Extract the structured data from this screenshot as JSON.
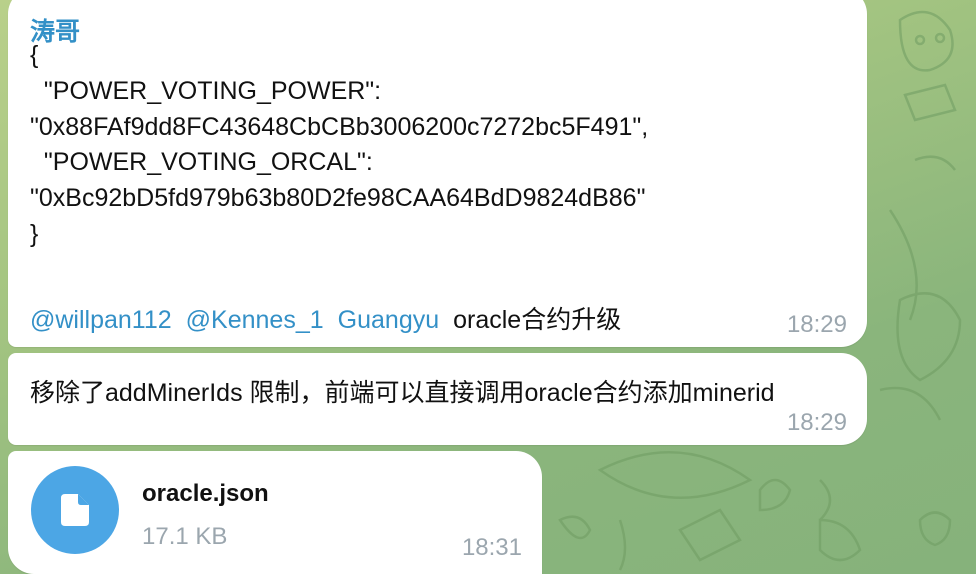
{
  "chat": {
    "message1": {
      "sender": "涛哥",
      "code_lines": [
        "{",
        "  \"POWER_VOTING_POWER\":",
        "\"0x88FAf9dd8FC43648CbCBb3006200c7272bc5F491\",",
        "  \"POWER_VOTING_ORCAL\":",
        "\"0xBc92bD5fd979b63b80D2fe98CAA64BdD9824dB86\"",
        "}"
      ],
      "mentions": [
        "@willpan112",
        "@Kennes_1",
        "Guangyu"
      ],
      "trailing_text": "oracle合约升级",
      "time": "18:29"
    },
    "message2": {
      "text": "移除了addMinerIds 限制，前端可以直接调用oracle合约添加minerid",
      "time": "18:29"
    },
    "message3": {
      "file_icon": "file-icon",
      "file_name": "oracle.json",
      "file_size": "17.1 KB",
      "time": "18:31"
    }
  },
  "colors": {
    "link": "#3390c7",
    "file_icon_bg": "#4ca6e5",
    "timestamp": "#9ba6ae",
    "background_start": "#b9d08a",
    "background_end": "#86b27b"
  }
}
